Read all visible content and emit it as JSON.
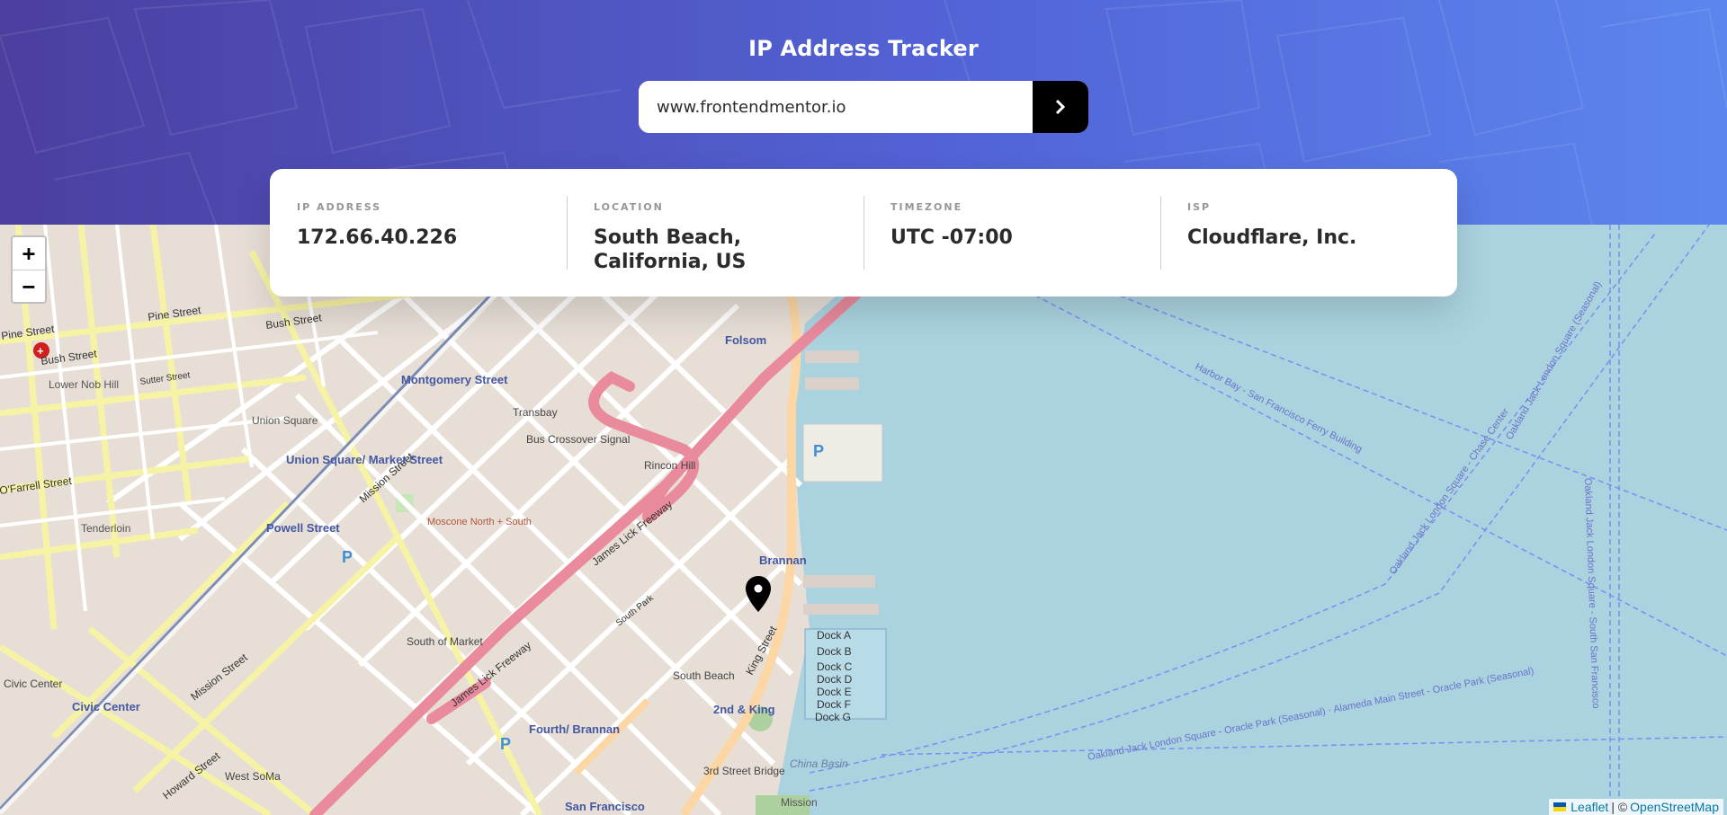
{
  "header": {
    "title": "IP Address Tracker",
    "gradient": [
      "#4b3fa0",
      "#5c86ee"
    ]
  },
  "search": {
    "value": "www.frontendmentor.io",
    "submit_icon": "chevron-right-icon"
  },
  "info": [
    {
      "label": "IP ADDRESS",
      "value": "172.66.40.226"
    },
    {
      "label": "LOCATION",
      "value": "South Beach, California, US"
    },
    {
      "label": "TIMEZONE",
      "value": "UTC -07:00"
    },
    {
      "label": "ISP",
      "value": "Cloudflare, Inc."
    }
  ],
  "map": {
    "zoom_in": "+",
    "zoom_out": "−",
    "marker_icon": "location-pin-icon",
    "labels": {
      "pine_street": "Pine Street",
      "bush_street": "Bush Street",
      "sutter_street": "Sutter Street",
      "lower_nob_hill": "Lower Nob Hill",
      "union_square": "Union Square",
      "union_square_station": "Union Square/ Market Street",
      "ofarrell": "O'Farrell Street",
      "tenderloin": "Tenderloin",
      "powell": "Powell Street",
      "montgomery": "Montgomery Street",
      "transbay": "Transbay",
      "bus_crossover": "Bus Crossover Signal",
      "rincon_hill": "Rincon Hill",
      "folsom": "Folsom",
      "mission_street": "Mission Street",
      "moscone": "Moscone North + South",
      "james_lick": "James Lick Freeway",
      "south_of_market": "South of Market",
      "south_park": "South Park",
      "brannan": "Brannan",
      "south_beach": "South Beach",
      "king_street": "King Street",
      "second_king": "2nd & King",
      "fourth_brannan": "Fourth/ Brannan",
      "civic_center_label": "Civic Center",
      "civic_center_station": "Civic Center",
      "west_soma": "West SoMa",
      "howard_street": "Howard Street",
      "third_bridge": "3rd Street Bridge",
      "san_francisco": "San Francisco",
      "mission_bay": "Mission",
      "china_basin": "China Basin",
      "docks": [
        "Dock A",
        "Dock B",
        "Dock C",
        "Dock D",
        "Dock E",
        "Dock F",
        "Dock G"
      ],
      "ferry_harbor_bay": "Harbor Bay - San Francisco Ferry Building",
      "ferry_oakland_alameda": "Oakland Jack London Square - Oracle Park (Seasonal) · Alameda Main Street - Oracle Park (Seasonal)",
      "ferry_oakland_vertical": "Oakland Jack London Square - South San Francisco",
      "ferry_chase": "Oakland Jack London Square - Chase Center",
      "ferry_oakland_oracle": "Oakland Jack London Square (Seasonal)"
    }
  },
  "attribution": {
    "leaflet": "Leaflet",
    "separator": " | © ",
    "osm": "OpenStreetMap"
  },
  "colors": {
    "water": "#aad3df",
    "land": "#e7dfd6",
    "freeway": "#e98a9d",
    "major_road": "#f7f3a4",
    "minor_road": "#ffffff"
  }
}
